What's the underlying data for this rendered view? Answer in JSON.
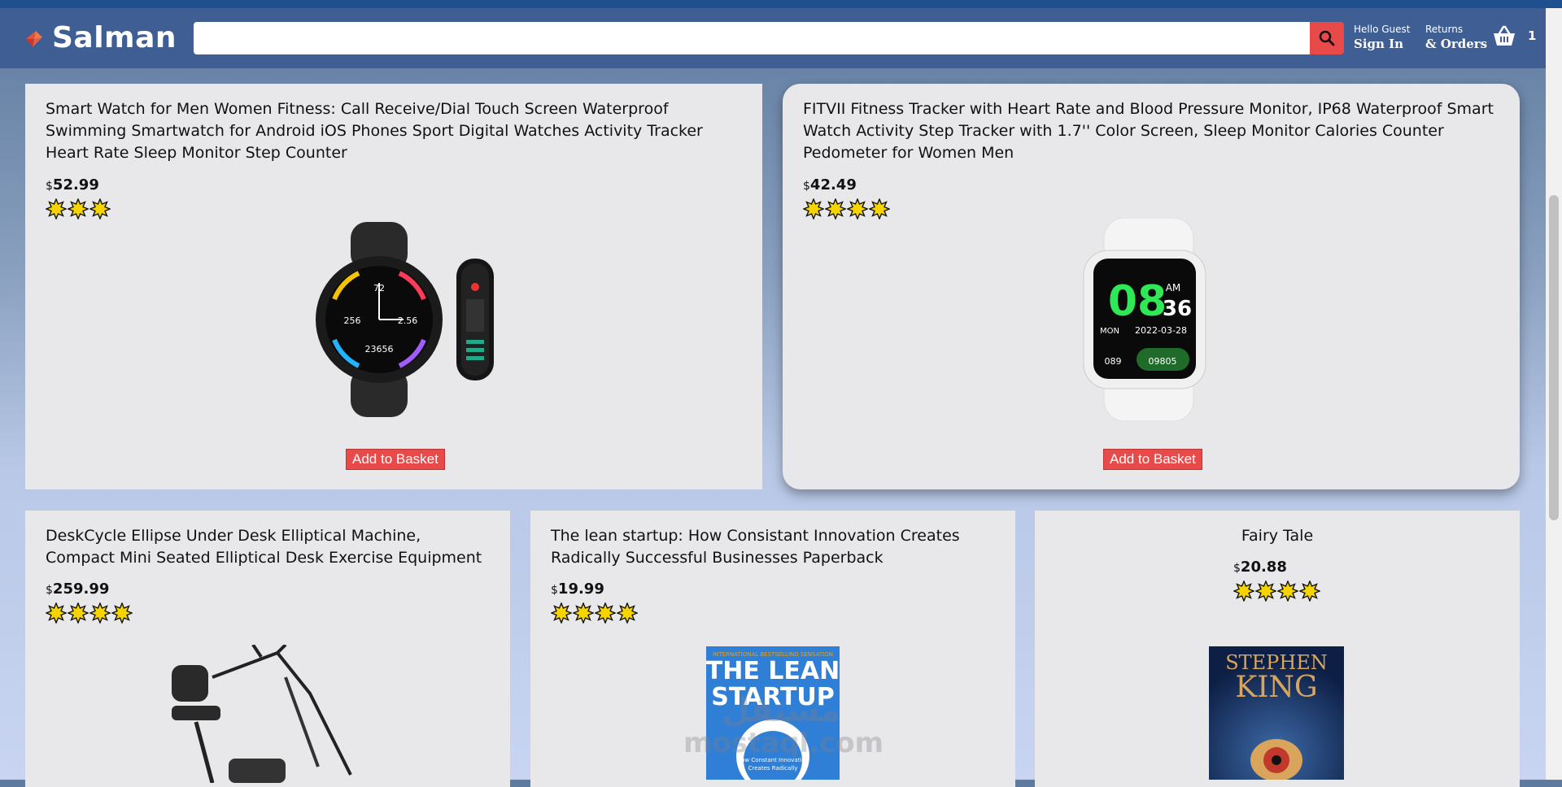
{
  "header": {
    "logo_text": "Salman",
    "search_placeholder": "",
    "greeting": "Hello Guest",
    "sign_in": "Sign In",
    "returns": "Returns",
    "orders": "& Orders",
    "basket_count": "1"
  },
  "colors": {
    "accent": "#e84a4a",
    "header": "#3f5f94",
    "card": "#e8e8ea"
  },
  "products": [
    {
      "title": "Smart Watch for Men Women Fitness: Call Receive/Dial Touch Screen Waterproof Swimming Smartwatch for Android iOS Phones Sport Digital Watches Activity Tracker Heart Rate Sleep Monitor Step Counter",
      "currency": "$",
      "price": "52.99",
      "rating": 3,
      "button": "Add to Basket",
      "image": "black-smartwatch-image",
      "watch_readings": {
        "heart": "72",
        "left": "256",
        "right": "2.56",
        "steps": "23656"
      }
    },
    {
      "title": "FITVII Fitness Tracker with Heart Rate and Blood Pressure Monitor, IP68 Waterproof Smart Watch Activity Step Tracker with 1.7'' Color Screen, Sleep Monitor Calories Counter Pedometer for Women Men",
      "currency": "$",
      "price": "42.49",
      "rating": 4,
      "button": "Add to Basket",
      "image": "white-fitness-tracker-image",
      "watch_readings": {
        "hour": "08",
        "minute": "36",
        "ampm": "AM",
        "day": "MON",
        "date": "2022-03-28",
        "heart": "089",
        "steps": "09805"
      }
    },
    {
      "title": "DeskCycle Ellipse Under Desk Elliptical Machine, Compact Mini Seated Elliptical Desk Exercise Equipment",
      "currency": "$",
      "price": "259.99",
      "rating": 4,
      "image": "elliptical-machine-image"
    },
    {
      "title": "The lean startup: How Consistant Innovation Creates Radically Successful Businesses Paperback",
      "currency": "$",
      "price": "19.99",
      "rating": 4,
      "image": "lean-startup-book-image",
      "book": {
        "banner": "INTERNATIONAL BESTSELLING SENSATION",
        "line1": "THE LEAN",
        "line2": "STARTUP",
        "sub1": "How Constant Innovation",
        "sub2": "Creates Radically"
      }
    },
    {
      "title": "Fairy Tale",
      "currency": "$",
      "price": "20.88",
      "rating": 4,
      "image": "fairy-tale-book-image",
      "book": {
        "author1": "STEPHEN",
        "author2": "KING"
      }
    }
  ],
  "watermark": {
    "arabic": "مستقل",
    "latin": "mostaql.com"
  }
}
